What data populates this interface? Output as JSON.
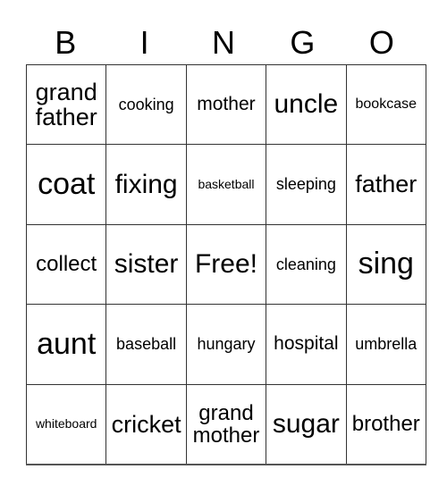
{
  "header": [
    "B",
    "I",
    "N",
    "G",
    "O"
  ],
  "rows": [
    [
      "grand\nfather",
      "cooking",
      "mother",
      "uncle",
      "bookcase"
    ],
    [
      "coat",
      "fixing",
      "basketball",
      "sleeping",
      "father"
    ],
    [
      "collect",
      "sister",
      "Free!",
      "cleaning",
      "sing"
    ],
    [
      "aunt",
      "baseball",
      "hungary",
      "hospital",
      "umbrella"
    ],
    [
      "whiteboard",
      "cricket",
      "grand\nmother",
      "sugar",
      "brother"
    ]
  ]
}
